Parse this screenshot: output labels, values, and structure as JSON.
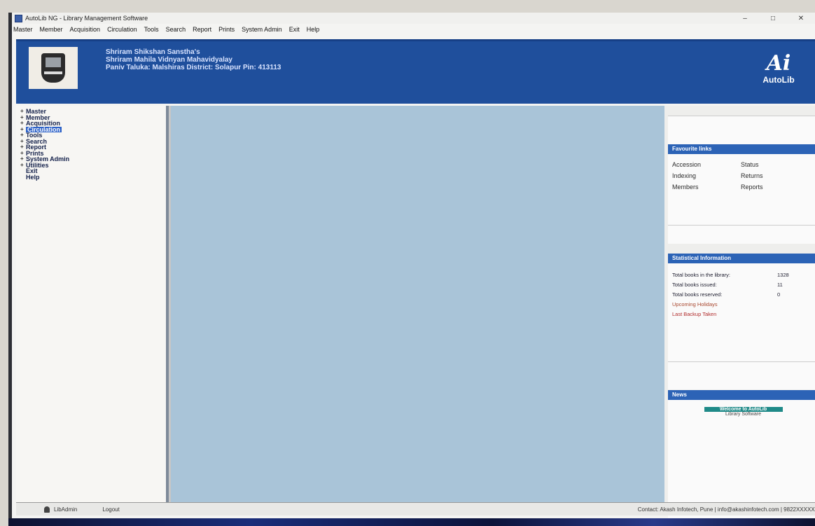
{
  "window": {
    "title": "AutoLib NG - Library Management Software",
    "controls": [
      "–",
      "□",
      "✕"
    ]
  },
  "menubar": [
    "Master",
    "Member",
    "Acquisition",
    "Circulation",
    "Tools",
    "Search",
    "Report",
    "Prints",
    "System Admin",
    "Exit",
    "Help"
  ],
  "banner": {
    "line1": "Shriram Shikshan Sanstha's",
    "line2": "Shriram Mahila Vidnyan Mahavidyalay",
    "line3": "Paniv Taluka: Malshiras District: Solapur Pin: 413113",
    "brand_mark": "Ai",
    "brand_name": "AutoLib"
  },
  "sidebar": {
    "items": [
      {
        "label": "Master",
        "twisty": "+"
      },
      {
        "label": "Member",
        "twisty": "+"
      },
      {
        "label": "Acquisition",
        "twisty": "+"
      },
      {
        "label": "Circulation",
        "twisty": "+",
        "selected": true
      },
      {
        "label": "Tools",
        "twisty": "+"
      },
      {
        "label": "Search",
        "twisty": "+"
      },
      {
        "label": "Report",
        "twisty": "+"
      },
      {
        "label": "Prints",
        "twisty": "+"
      },
      {
        "label": "System Admin",
        "twisty": "+"
      },
      {
        "label": "Utilities",
        "twisty": "+"
      },
      {
        "label": "Exit",
        "twisty": ""
      },
      {
        "label": "Help",
        "twisty": ""
      }
    ]
  },
  "favorite_links": {
    "title": "Favourite links",
    "links": [
      "Accession",
      "Status",
      "Indexing",
      "Returns",
      "Members",
      "Reports"
    ]
  },
  "statistical_info": {
    "title": "Statistical Information",
    "rows": [
      {
        "label": "Total books in the library:",
        "value": "1328"
      },
      {
        "label": "Total books issued:",
        "value": "11"
      },
      {
        "label": "Total books reserved:",
        "value": "0"
      }
    ],
    "upcoming": "Upcoming Holidays",
    "last_backup": "Last Backup Taken"
  },
  "news": {
    "title": "News",
    "headline": "Welcome to AutoLib",
    "subtext": "Library Software"
  },
  "statusbar": {
    "user": "LibAdmin",
    "logout": "Logout",
    "contact": "Contact: Akash Infotech, Pune | info@akashinfotech.com | 9822XXXXXX"
  }
}
